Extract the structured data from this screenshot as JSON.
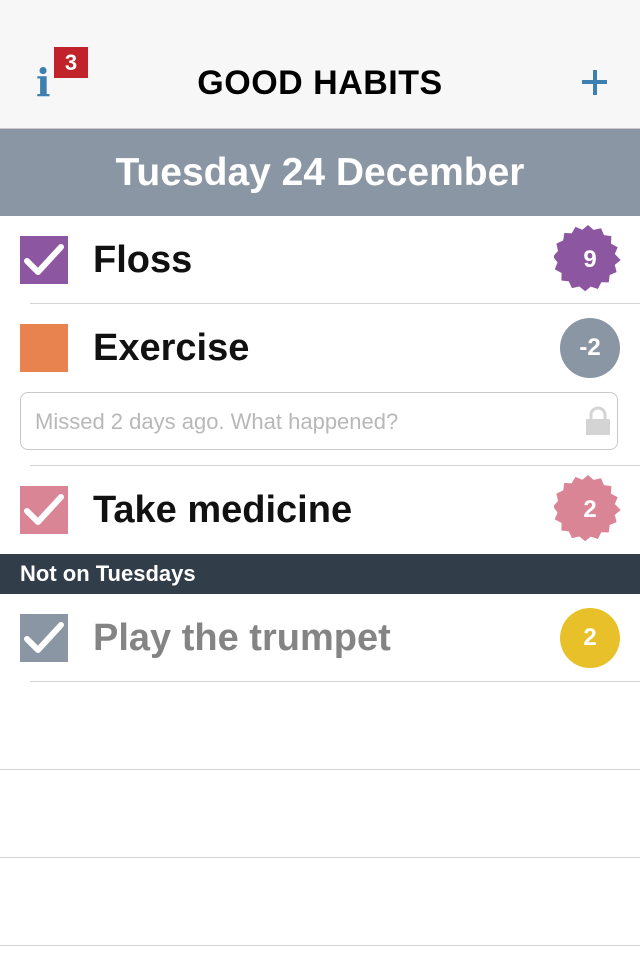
{
  "navbar": {
    "title": "GOOD HABITS",
    "info_icon": "info-icon",
    "info_glyph": "i",
    "notification_count": "3",
    "add_icon": "plus-icon"
  },
  "date_header": "Tuesday 24 December",
  "habits": [
    {
      "label": "Floss",
      "checked": true,
      "color": "#8d56a0",
      "streak": "9",
      "badge_shape": "starburst",
      "badge_color": "#8d56a0"
    },
    {
      "label": "Exercise",
      "checked": false,
      "color": "#e8834f",
      "streak": "-2",
      "badge_shape": "circle",
      "badge_color": "#8a96a3",
      "note_placeholder": "Missed 2 days ago. What happened?",
      "note_value": "",
      "note_icon": "lock-icon"
    },
    {
      "label": "Take medicine",
      "checked": true,
      "color": "#d98596",
      "streak": "2",
      "badge_shape": "starburst",
      "badge_color": "#d98596"
    }
  ],
  "section": {
    "title": "Not on Tuesdays",
    "habits": [
      {
        "label": "Play the trumpet",
        "checked": true,
        "color": "#8a96a3",
        "streak": "2",
        "badge_shape": "circle",
        "badge_color": "#e8c12a"
      }
    ]
  },
  "colors": {
    "accent": "#3f7fb0",
    "badge_red": "#c0232a",
    "header_gray": "#8a96a3",
    "section_dark": "#323d4a",
    "disabled_text": "#848484"
  }
}
